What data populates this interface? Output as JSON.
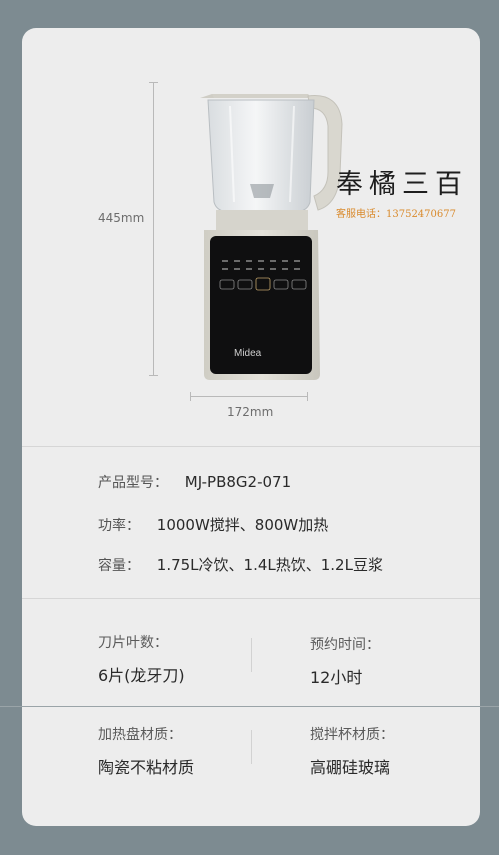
{
  "dimensions": {
    "height_label": "445mm",
    "width_label": "172mm"
  },
  "blender": {
    "brand": "Midea"
  },
  "watermark": {
    "title": "奉橘三百",
    "contact": "客服电话：13752470677"
  },
  "specs": {
    "model_label": "产品型号：",
    "model_value": "MJ-PB8G2-071",
    "power_label": "功率：",
    "power_value": "1000W搅拌、800W加热",
    "capacity_label": "容量：",
    "capacity_value": "1.75L冷饮、1.4L热饮、1.2L豆浆"
  },
  "features": {
    "blades_label": "刀片叶数：",
    "blades_value": "6片(龙牙刀)",
    "timer_label": "预约时间：",
    "timer_value": "12小时",
    "plate_label": "加热盘材质：",
    "plate_value": "陶瓷不粘材质",
    "cup_label": "搅拌杯材质：",
    "cup_value": "高硼硅玻璃"
  }
}
